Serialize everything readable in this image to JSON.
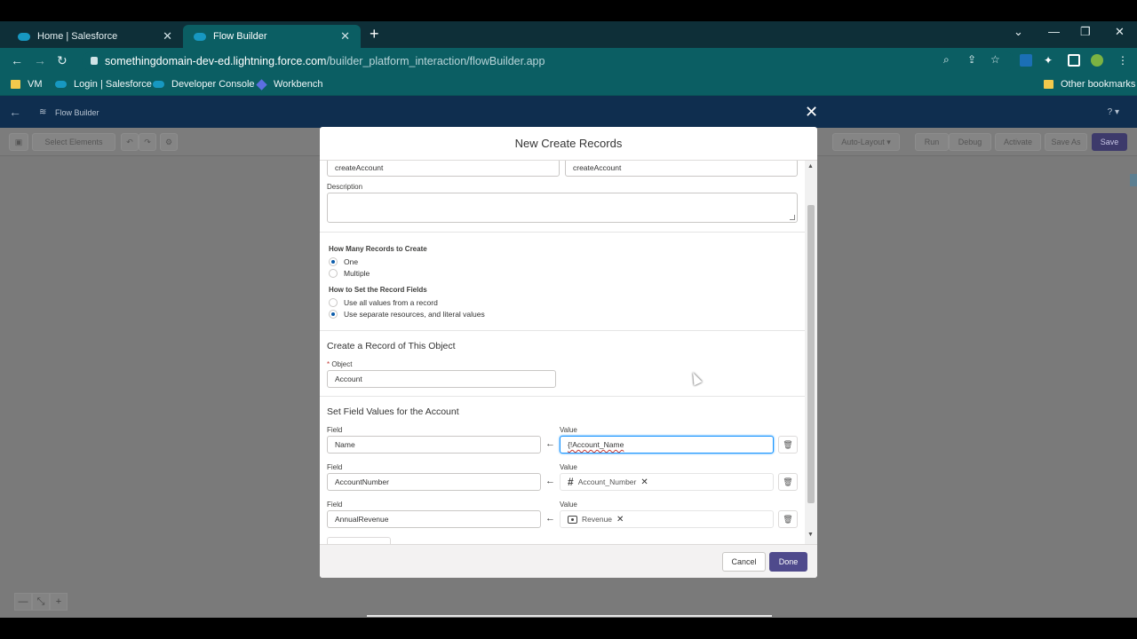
{
  "browser": {
    "tabs": [
      {
        "label": "Home | Salesforce",
        "active": false
      },
      {
        "label": "Flow Builder",
        "active": true
      }
    ],
    "url_host": "somethingdomain-dev-ed.lightning.force.com",
    "url_path": "/builder_platform_interaction/flowBuilder.app",
    "bookmarks": [
      "VM",
      "Login | Salesforce",
      "Developer Console",
      "Workbench"
    ],
    "other_bookmarks": "Other bookmarks"
  },
  "app": {
    "title": "Flow Builder",
    "help": "? ▾",
    "toolbar": {
      "select_elements": "Select Elements",
      "auto_layout": "Auto-Layout",
      "run": "Run",
      "debug": "Debug",
      "activate": "Activate",
      "save_as": "Save As",
      "save": "Save"
    }
  },
  "modal": {
    "title": "New Create Records",
    "label_value": "createAccount",
    "api_name_value": "createAccount",
    "description_label": "Description",
    "how_many_label": "How Many Records to Create",
    "how_many_options": [
      "One",
      "Multiple"
    ],
    "how_many_selected": "One",
    "how_set_label": "How to Set the Record Fields",
    "how_set_options": [
      "Use all values from a record",
      "Use separate resources, and literal values"
    ],
    "how_set_selected": "Use separate resources, and literal values",
    "object_section_title": "Create a Record of This Object",
    "object_label": "Object",
    "object_required_mark": "*",
    "object_value": "Account",
    "field_values_title": "Set Field Values for the Account",
    "field_label": "Field",
    "value_label": "Value",
    "rows": [
      {
        "field": "Name",
        "value": "{!Account_Name",
        "type": "typed"
      },
      {
        "field": "AccountNumber",
        "value": "Account_Number",
        "type": "number-pill"
      },
      {
        "field": "AnnualRevenue",
        "value": "Revenue",
        "type": "currency-pill"
      }
    ],
    "cancel": "Cancel",
    "done": "Done"
  }
}
